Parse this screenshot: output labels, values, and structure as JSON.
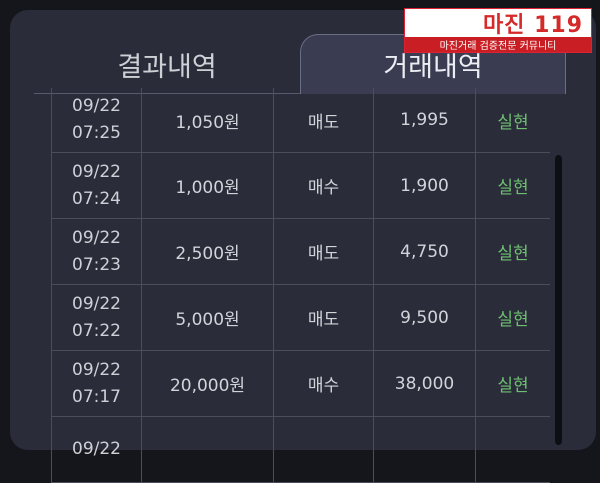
{
  "tabs": {
    "left": "결과내역",
    "right": "거래내역"
  },
  "logo": {
    "title": "마진 119",
    "subtitle": "마진거래 검증전문 커뮤니티"
  },
  "colors": {
    "panel": "#2a2c39",
    "status_green": "#6fbf72",
    "logo_red": "#c81e24"
  },
  "rows": [
    {
      "date": "09/22",
      "time": "07:25",
      "amount": "1,050원",
      "type": "매도",
      "price": "1,995",
      "status": "실현"
    },
    {
      "date": "09/22",
      "time": "07:24",
      "amount": "1,000원",
      "type": "매수",
      "price": "1,900",
      "status": "실현"
    },
    {
      "date": "09/22",
      "time": "07:23",
      "amount": "2,500원",
      "type": "매도",
      "price": "4,750",
      "status": "실현"
    },
    {
      "date": "09/22",
      "time": "07:22",
      "amount": "5,000원",
      "type": "매도",
      "price": "9,500",
      "status": "실현"
    },
    {
      "date": "09/22",
      "time": "07:17",
      "amount": "20,000원",
      "type": "매수",
      "price": "38,000",
      "status": "실현"
    },
    {
      "date": "09/22",
      "time": "",
      "amount": "",
      "type": "",
      "price": "",
      "status": ""
    }
  ]
}
